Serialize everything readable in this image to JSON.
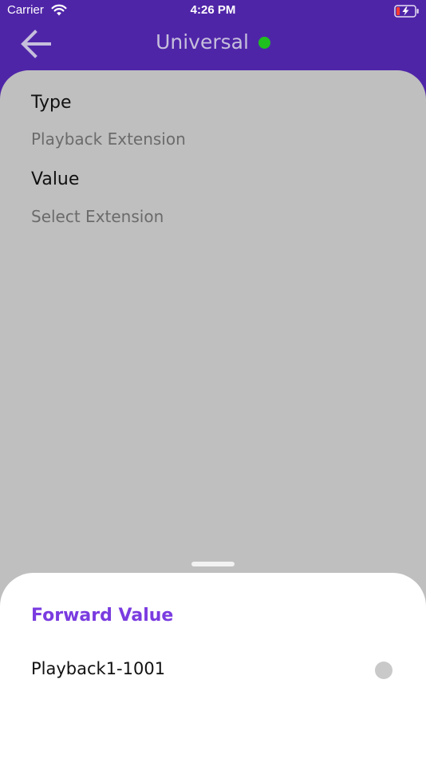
{
  "status_bar": {
    "carrier": "Carrier",
    "time": "4:26 PM"
  },
  "header": {
    "title": "Universal",
    "connection_status_color": "#1fbf1f",
    "back_icon": "arrow-left-icon"
  },
  "fields": [
    {
      "label": "Type",
      "value": "Playback Extension"
    },
    {
      "label": "Value",
      "value": "Select Extension"
    }
  ],
  "bottom_sheet": {
    "title": "Forward Value",
    "options": [
      {
        "label": "Playback1-1001",
        "selected": false
      }
    ]
  },
  "colors": {
    "header_bg": "#4f25a8",
    "accent": "#7a3be0",
    "overlay": "#bfbfbf"
  }
}
